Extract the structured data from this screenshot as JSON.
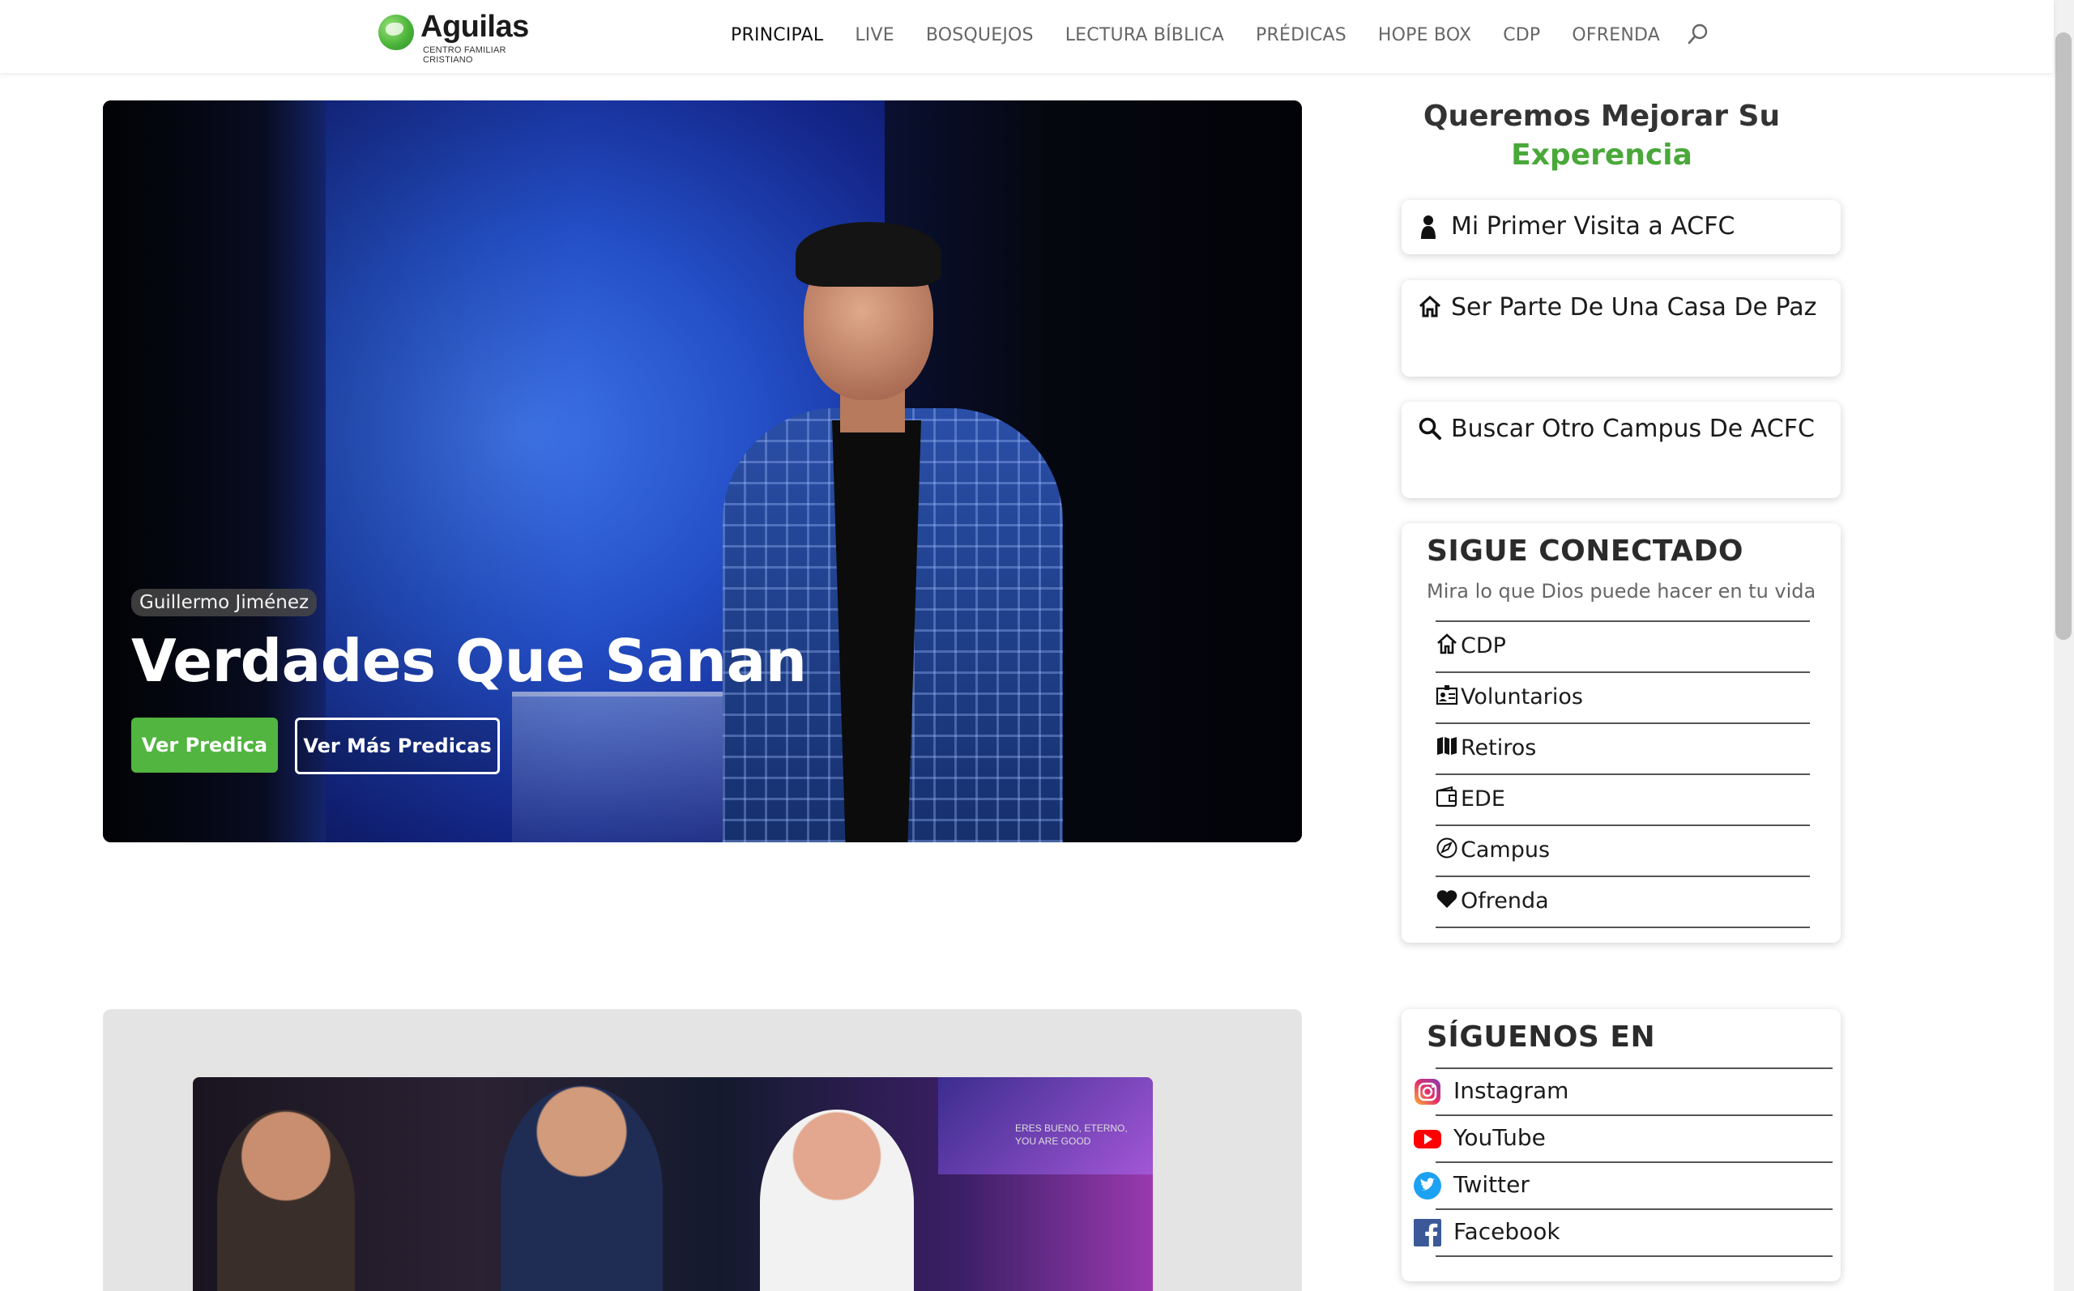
{
  "header": {
    "logo_name": "Aguilas",
    "logo_sub": "CENTRO FAMILIAR CRISTIANO",
    "nav": [
      "PRINCIPAL",
      "LIVE",
      "BOSQUEJOS",
      "LECTURA BÍBLICA",
      "PRÉDICAS",
      "HOPE BOX",
      "CDP",
      "OFRENDA"
    ],
    "active_nav": "PRINCIPAL",
    "search_icon": "search-icon"
  },
  "hero": {
    "badge": "Guillermo Jiménez",
    "title": "Verdades Que Sanan",
    "primary_button": "Ver Predica",
    "secondary_button": "Ver Más Predicas"
  },
  "card2": {
    "screen_text_1": "ERES BUENO, ETERNO,",
    "screen_text_2": "YOU ARE GOOD"
  },
  "sidebar": {
    "heading_line1": "Queremos Mejorar Su",
    "heading_line2": "Experencia",
    "experience_buttons": [
      {
        "label": "Mi Primer Visita a ACFC",
        "icon": "person-icon"
      },
      {
        "label": "Ser Parte De Una Casa De Paz",
        "icon": "home-icon"
      },
      {
        "label": "Buscar Otro Campus De ACFC",
        "icon": "search-icon"
      }
    ],
    "connected": {
      "title": "SIGUE CONECTADO",
      "subtitle": "Mira lo que Dios puede hacer en tu vida",
      "items": [
        {
          "label": "CDP",
          "icon": "home-icon"
        },
        {
          "label": "Voluntarios",
          "icon": "id-card-icon"
        },
        {
          "label": "Retiros",
          "icon": "map-icon"
        },
        {
          "label": "EDE",
          "icon": "wallet-icon"
        },
        {
          "label": "Campus",
          "icon": "compass-icon"
        },
        {
          "label": "Ofrenda",
          "icon": "heart-icon"
        }
      ]
    },
    "social": {
      "title": "SÍGUENOS EN",
      "items": [
        {
          "label": "Instagram",
          "icon": "instagram-icon",
          "color": "#e1306c"
        },
        {
          "label": "YouTube",
          "icon": "youtube-icon",
          "color": "#ff0000"
        },
        {
          "label": "Twitter",
          "icon": "twitter-icon",
          "color": "#1da1f2"
        },
        {
          "label": "Facebook",
          "icon": "facebook-icon",
          "color": "#3b5998"
        }
      ]
    }
  },
  "colors": {
    "accent_green": "#52b540",
    "heading_green": "#4aa83a"
  }
}
